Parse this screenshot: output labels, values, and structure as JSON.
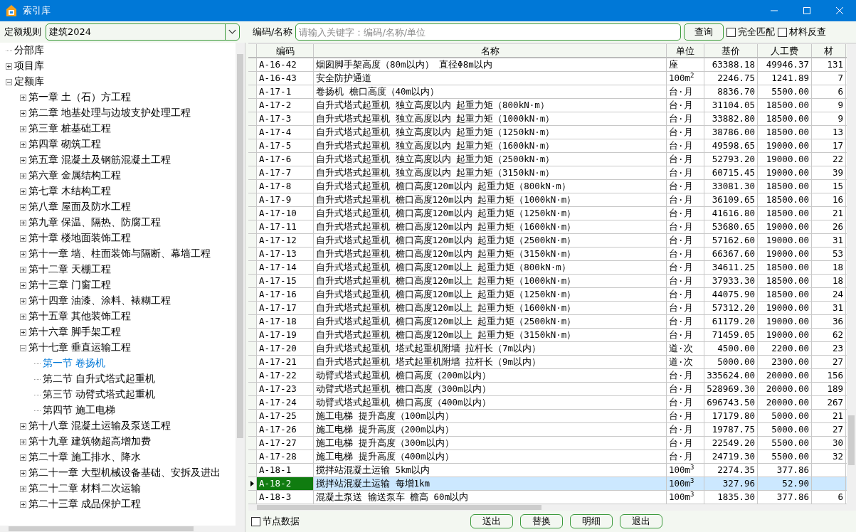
{
  "window": {
    "title": "索引库"
  },
  "filter": {
    "rule_label": "定额规则",
    "rule_value": "建筑2024",
    "search_label": "编码/名称",
    "search_placeholder": "请输入关键字：编码/名称/单位",
    "search_button": "查询",
    "checkboxes": [
      {
        "label": "完全匹配",
        "checked": false
      },
      {
        "label": "材料反查",
        "checked": false
      }
    ]
  },
  "tree": [
    {
      "label": "分部库"
    },
    {
      "label": "项目库",
      "expanded": false
    },
    {
      "label": "定额库",
      "expanded": true,
      "children": [
        {
          "label": "第一章  土（石）方工程",
          "expanded": false
        },
        {
          "label": "第二章  地基处理与边坡支护处理工程",
          "expanded": false
        },
        {
          "label": "第三章  桩基础工程",
          "expanded": false
        },
        {
          "label": "第四章  砌筑工程",
          "expanded": false
        },
        {
          "label": "第五章  混凝土及钢筋混凝土工程",
          "expanded": false
        },
        {
          "label": "第六章  金属结构工程",
          "expanded": false
        },
        {
          "label": "第七章  木结构工程",
          "expanded": false
        },
        {
          "label": "第八章  屋面及防水工程",
          "expanded": false
        },
        {
          "label": "第九章  保温、隔热、防腐工程",
          "expanded": false
        },
        {
          "label": "第十章  楼地面装饰工程",
          "expanded": false
        },
        {
          "label": "第十一章  墙、柱面装饰与隔断、幕墙工程",
          "expanded": false
        },
        {
          "label": "第十二章  天棚工程",
          "expanded": false
        },
        {
          "label": "第十三章  门窗工程",
          "expanded": false
        },
        {
          "label": "第十四章  油漆、涂料、裱糊工程",
          "expanded": false
        },
        {
          "label": "第十五章  其他装饰工程",
          "expanded": false
        },
        {
          "label": "第十六章  脚手架工程",
          "expanded": false
        },
        {
          "label": "第十七章  垂直运输工程",
          "expanded": true,
          "children": [
            {
              "label": "第一节  卷扬机",
              "selected": true
            },
            {
              "label": "第二节  自升式塔式起重机",
              "selected": false
            },
            {
              "label": "第三节  动臂式塔式起重机",
              "selected": false
            },
            {
              "label": "第四节  施工电梯",
              "selected": false
            }
          ]
        },
        {
          "label": "第十八章  混凝土运输及泵送工程",
          "expanded": false
        },
        {
          "label": "第十九章  建筑物超高增加费",
          "expanded": false
        },
        {
          "label": "第二十章  施工排水、降水",
          "expanded": false
        },
        {
          "label": "第二十一章  大型机械设备基础、安拆及进出",
          "expanded": false
        },
        {
          "label": "第二十二章  材料二次运输",
          "expanded": false
        },
        {
          "label": "第二十三章  成品保护工程",
          "expanded": false
        }
      ]
    }
  ],
  "table": {
    "columns": [
      "编码",
      "名称",
      "单位",
      "基价",
      "人工费",
      "材"
    ],
    "rows": [
      {
        "code": "A-16-42",
        "name": "烟囱脚手架高度（80m以内） 直径Φ8m以内",
        "unit": "座",
        "base_price": "63388.18",
        "labor": "49946.37",
        "column_6": "131",
        "selected": false
      },
      {
        "code": "A-16-43",
        "name": "安全防护通道",
        "unit": "100m$^{2}$",
        "base_price": "2246.75",
        "labor": "1241.89",
        "column_6": "7",
        "selected": false
      },
      {
        "code": "A-17-1",
        "name": "卷扬机 檐口高度（40m以内）",
        "unit": "台·月",
        "base_price": "8836.70",
        "labor": "5500.00",
        "column_6": "6",
        "selected": false
      },
      {
        "code": "A-17-2",
        "name": "自升式塔式起重机 独立高度以内 起重力矩（800kN·m）",
        "unit": "台·月",
        "base_price": "31104.05",
        "labor": "18500.00",
        "column_6": "9",
        "selected": false
      },
      {
        "code": "A-17-3",
        "name": "自升式塔式起重机 独立高度以内 起重力矩（1000kN·m）",
        "unit": "台·月",
        "base_price": "33882.80",
        "labor": "18500.00",
        "column_6": "9",
        "selected": false
      },
      {
        "code": "A-17-4",
        "name": "自升式塔式起重机 独立高度以内 起重力矩（1250kN·m）",
        "unit": "台·月",
        "base_price": "38786.00",
        "labor": "18500.00",
        "column_6": "13",
        "selected": false
      },
      {
        "code": "A-17-5",
        "name": "自升式塔式起重机 独立高度以内 起重力矩（1600kN·m）",
        "unit": "台·月",
        "base_price": "49598.65",
        "labor": "19000.00",
        "column_6": "17",
        "selected": false
      },
      {
        "code": "A-17-6",
        "name": "自升式塔式起重机 独立高度以内 起重力矩（2500kN·m）",
        "unit": "台·月",
        "base_price": "52793.20",
        "labor": "19000.00",
        "column_6": "22",
        "selected": false
      },
      {
        "code": "A-17-7",
        "name": "自升式塔式起重机 独立高度以内 起重力矩（3150kN·m）",
        "unit": "台·月",
        "base_price": "60715.45",
        "labor": "19000.00",
        "column_6": "39",
        "selected": false
      },
      {
        "code": "A-17-8",
        "name": "自升式塔式起重机 檐口高度120m以内 起重力矩（800kN·m）",
        "unit": "台·月",
        "base_price": "33081.30",
        "labor": "18500.00",
        "column_6": "15",
        "selected": false
      },
      {
        "code": "A-17-9",
        "name": "自升式塔式起重机 檐口高度120m以内 起重力矩（1000kN·m）",
        "unit": "台·月",
        "base_price": "36109.65",
        "labor": "18500.00",
        "column_6": "16",
        "selected": false
      },
      {
        "code": "A-17-10",
        "name": "自升式塔式起重机 檐口高度120m以内 起重力矩（1250kN·m）",
        "unit": "台·月",
        "base_price": "41616.80",
        "labor": "18500.00",
        "column_6": "21",
        "selected": false
      },
      {
        "code": "A-17-11",
        "name": "自升式塔式起重机 檐口高度120m以内 起重力矩（1600kN·m）",
        "unit": "台·月",
        "base_price": "53680.65",
        "labor": "19000.00",
        "column_6": "26",
        "selected": false
      },
      {
        "code": "A-17-12",
        "name": "自升式塔式起重机 檐口高度120m以内 起重力矩（2500kN·m）",
        "unit": "台·月",
        "base_price": "57162.60",
        "labor": "19000.00",
        "column_6": "31",
        "selected": false
      },
      {
        "code": "A-17-13",
        "name": "自升式塔式起重机 檐口高度120m以内 起重力矩（3150kN·m）",
        "unit": "台·月",
        "base_price": "66367.60",
        "labor": "19000.00",
        "column_6": "53",
        "selected": false
      },
      {
        "code": "A-17-14",
        "name": "自升式塔式起重机 檐口高度120m以上 起重力矩（800kN·m）",
        "unit": "台·月",
        "base_price": "34611.25",
        "labor": "18500.00",
        "column_6": "18",
        "selected": false
      },
      {
        "code": "A-17-15",
        "name": "自升式塔式起重机 檐口高度120m以上 起重力矩（1000kN·m）",
        "unit": "台·月",
        "base_price": "37933.30",
        "labor": "18500.00",
        "column_6": "18",
        "selected": false
      },
      {
        "code": "A-17-16",
        "name": "自升式塔式起重机 檐口高度120m以上 起重力矩（1250kN·m）",
        "unit": "台·月",
        "base_price": "44075.90",
        "labor": "18500.00",
        "column_6": "24",
        "selected": false
      },
      {
        "code": "A-17-17",
        "name": "自升式塔式起重机 檐口高度120m以上 起重力矩（1600kN·m）",
        "unit": "台·月",
        "base_price": "57312.20",
        "labor": "19000.00",
        "column_6": "31",
        "selected": false
      },
      {
        "code": "A-17-18",
        "name": "自升式塔式起重机 檐口高度120m以上 起重力矩（2500kN·m）",
        "unit": "台·月",
        "base_price": "61179.20",
        "labor": "19000.00",
        "column_6": "36",
        "selected": false
      },
      {
        "code": "A-17-19",
        "name": "自升式塔式起重机 檐口高度120m以上 起重力矩（3150kN·m）",
        "unit": "台·月",
        "base_price": "71459.05",
        "labor": "19000.00",
        "column_6": "62",
        "selected": false
      },
      {
        "code": "A-17-20",
        "name": "自升式塔式起重机 塔式起重机附墙 拉杆长（7m以内）",
        "unit": "道·次",
        "base_price": "4500.00",
        "labor": "2200.00",
        "column_6": "23",
        "selected": false
      },
      {
        "code": "A-17-21",
        "name": "自升式塔式起重机 塔式起重机附墙 拉杆长（9m以内）",
        "unit": "道·次",
        "base_price": "5000.00",
        "labor": "2300.00",
        "column_6": "27",
        "selected": false
      },
      {
        "code": "A-17-22",
        "name": "动臂式塔式起重机 檐口高度（200m以内）",
        "unit": "台·月",
        "base_price": "335624.00",
        "labor": "20000.00",
        "column_6": "156",
        "selected": false
      },
      {
        "code": "A-17-23",
        "name": "动臂式塔式起重机 檐口高度（300m以内）",
        "unit": "台·月",
        "base_price": "528969.30",
        "labor": "20000.00",
        "column_6": "189",
        "selected": false
      },
      {
        "code": "A-17-24",
        "name": "动臂式塔式起重机 檐口高度（400m以内）",
        "unit": "台·月",
        "base_price": "696743.50",
        "labor": "20000.00",
        "column_6": "267",
        "selected": false
      },
      {
        "code": "A-17-25",
        "name": "施工电梯 提升高度（100m以内）",
        "unit": "台·月",
        "base_price": "17179.80",
        "labor": "5000.00",
        "column_6": "21",
        "selected": false
      },
      {
        "code": "A-17-26",
        "name": "施工电梯 提升高度（200m以内）",
        "unit": "台·月",
        "base_price": "19787.75",
        "labor": "5000.00",
        "column_6": "27",
        "selected": false
      },
      {
        "code": "A-17-27",
        "name": "施工电梯 提升高度（300m以内）",
        "unit": "台·月",
        "base_price": "22549.20",
        "labor": "5500.00",
        "column_6": "30",
        "selected": false
      },
      {
        "code": "A-17-28",
        "name": "施工电梯 提升高度（400m以内）",
        "unit": "台·月",
        "base_price": "24719.30",
        "labor": "5500.00",
        "column_6": "32",
        "selected": false
      },
      {
        "code": "A-18-1",
        "name": "搅拌站混凝土运输 5km以内",
        "unit": "100m$^{3}$",
        "base_price": "2274.35",
        "labor": "377.86",
        "selected": false
      },
      {
        "code": "A-18-2",
        "name": "搅拌站混凝土运输 每增1km",
        "unit": "100m$^{3}$",
        "base_price": "327.96",
        "labor": "52.90",
        "selected": true
      },
      {
        "code": "A-18-3",
        "name": "混凝土泵送 输送泵车 檐高 60m以内",
        "unit": "100m$^{3}$",
        "base_price": "1835.30",
        "labor": "377.86",
        "column_6": "6",
        "selected": false
      }
    ]
  },
  "footer": {
    "checkbox": {
      "label": "节点数据",
      "checked": false
    },
    "buttons": [
      "送出",
      "替换",
      "明细",
      "退出"
    ]
  }
}
